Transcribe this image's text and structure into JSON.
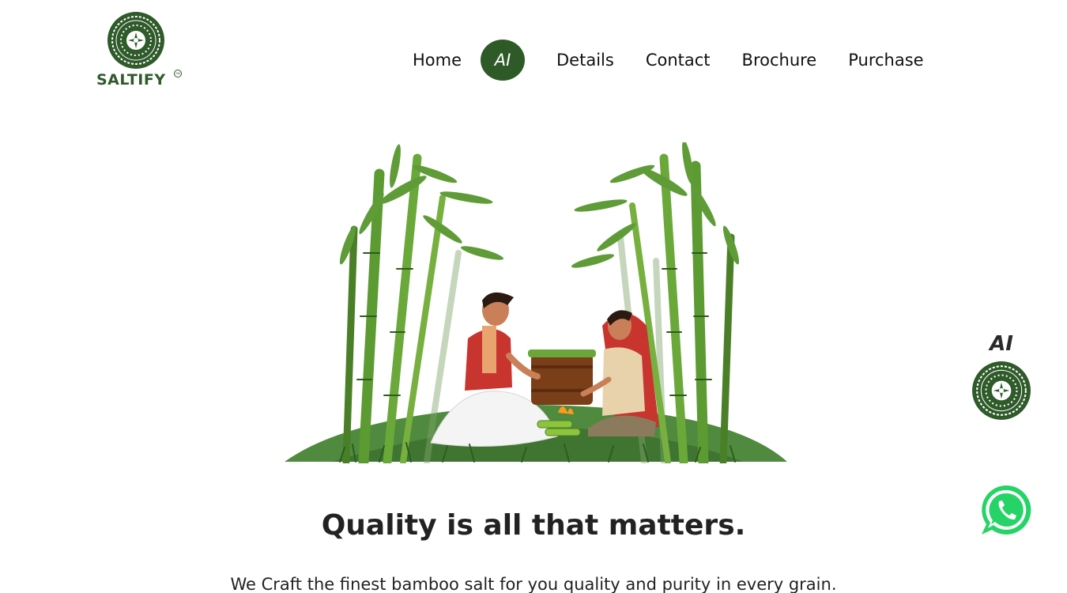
{
  "brand": {
    "name": "SALTIFY",
    "reg_mark": "SM",
    "primary_color": "#2e5a27"
  },
  "nav": {
    "items": [
      {
        "label": "Home",
        "active": false
      },
      {
        "label": "AI",
        "active": true
      },
      {
        "label": "Details",
        "active": false
      },
      {
        "label": "Contact",
        "active": false
      },
      {
        "label": "Brochure",
        "active": false
      },
      {
        "label": "Purchase",
        "active": false
      }
    ]
  },
  "hero": {
    "illustration": "bamboo-salt-makers-illustration"
  },
  "content": {
    "headline": "Quality is all that matters.",
    "tagline": "We Craft the finest bamboo salt for you quality and purity in every grain."
  },
  "widgets": {
    "ai_label": "AI",
    "ai_icon": "saltify-emblem-icon",
    "whatsapp_icon": "whatsapp-icon",
    "whatsapp_color": "#25d366"
  }
}
